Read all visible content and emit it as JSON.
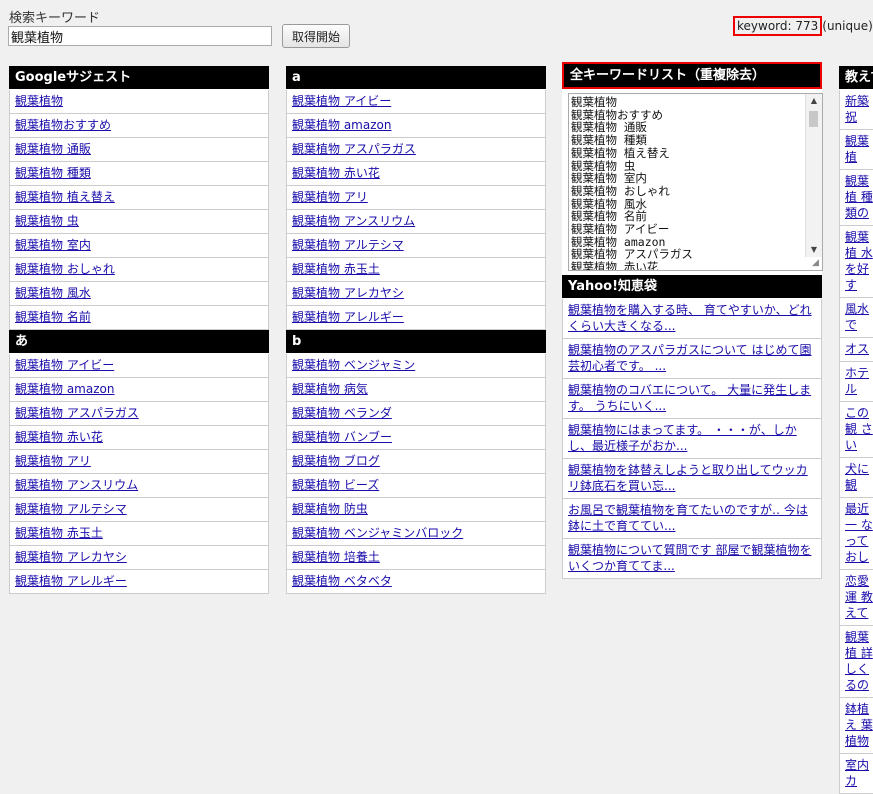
{
  "search": {
    "label": "検索キーワード",
    "value": "観葉植物"
  },
  "fetch_button": "取得開始",
  "count": {
    "label": "keyword: 773",
    "suffix": "(unique)"
  },
  "col1": {
    "header": "Googleサジェスト",
    "items": [
      "観葉植物",
      "観葉植物おすすめ",
      "観葉植物 通販",
      "観葉植物 種類",
      "観葉植物 植え替え",
      "観葉植物 虫",
      "観葉植物 室内",
      "観葉植物 おしゃれ",
      "観葉植物 風水",
      "観葉植物 名前"
    ],
    "header2": "あ",
    "items2": [
      "観葉植物 アイビー",
      "観葉植物 amazon",
      "観葉植物 アスパラガス",
      "観葉植物 赤い花",
      "観葉植物 アリ",
      "観葉植物 アンスリウム",
      "観葉植物 アルテシマ",
      "観葉植物 赤玉土",
      "観葉植物 アレカヤシ",
      "観葉植物 アレルギー"
    ]
  },
  "col2": {
    "header": "a",
    "items": [
      "観葉植物 アイビー",
      "観葉植物 amazon",
      "観葉植物 アスパラガス",
      "観葉植物 赤い花",
      "観葉植物 アリ",
      "観葉植物 アンスリウム",
      "観葉植物 アルテシマ",
      "観葉植物 赤玉土",
      "観葉植物 アレカヤシ",
      "観葉植物 アレルギー"
    ],
    "header2": "b",
    "items2": [
      "観葉植物 ベンジャミン",
      "観葉植物 病気",
      "観葉植物 ベランダ",
      "観葉植物 バンブー",
      "観葉植物 ブログ",
      "観葉植物 ビーズ",
      "観葉植物 防虫",
      "観葉植物 ベンジャミンバロック",
      "観葉植物 培養土",
      "観葉植物 ベタベタ"
    ]
  },
  "col3": {
    "header": "全キーワードリスト（重複除去）",
    "keywords": [
      "観葉植物",
      "観葉植物おすすめ",
      "観葉植物 通販",
      "観葉植物 種類",
      "観葉植物 植え替え",
      "観葉植物 虫",
      "観葉植物 室内",
      "観葉植物 おしゃれ",
      "観葉植物 風水",
      "観葉植物 名前",
      "観葉植物 アイビー",
      "観葉植物 amazon",
      "観葉植物 アスパラガス",
      "観葉植物 赤い花"
    ],
    "header2": "Yahoo!知恵袋",
    "questions": [
      "観葉植物を購入する時、 育てやすいか、どれくらい大きくなる...",
      "観葉植物のアスパラガスについて はじめて園芸初心者です。 ...",
      "観葉植物のコバエについて。 大量に発生します。 うちにいく...",
      "観葉植物にはまってます。 ・・・が、しかし、最近様子がおか...",
      "観葉植物を鉢替えしようと取り出してウッカリ鉢底石を買い忘...",
      "お風呂で観葉植物を育てたいのですが‥ 今は鉢に土で育ててい...",
      "観葉植物について質問です 部屋で観葉植物をいくつか育ててま..."
    ]
  },
  "col4": {
    "header": "教えて",
    "items": [
      "新築祝",
      "観葉植",
      "観葉植 種類の",
      "観葉植 水を好 す",
      "風水で",
      "オス",
      "ホテル",
      "この観 さい",
      "犬に観",
      "最近一 なって おし",
      "恋愛運 教えて",
      "観葉植 詳しく るの",
      "鉢植え 葉植物",
      "室内カ"
    ]
  }
}
